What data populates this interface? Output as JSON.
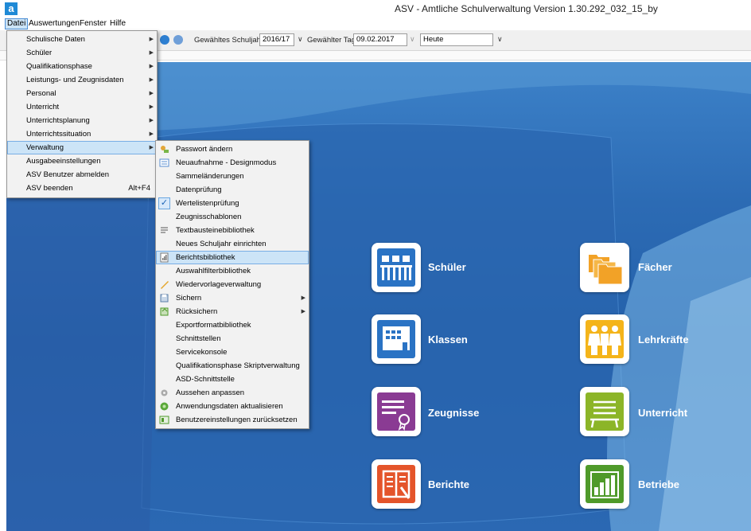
{
  "window": {
    "title": "ASV - Amtliche Schulverwaltung Version 1.30.292_032_15_by",
    "app_icon": "a"
  },
  "menubar": {
    "items": [
      "Datei",
      "Auswertungen",
      "Fenster",
      "Hilfe"
    ]
  },
  "toolbar": {
    "schuljahr_label": "Gewähltes Schuljahr",
    "schuljahr_value": "2016/17",
    "tag_label": "Gewählter Tag",
    "tag_value": "09.02.2017",
    "heute_value": "Heute"
  },
  "datei_menu": {
    "items": [
      "Schulische Daten",
      "Schüler",
      "Qualifikationsphase",
      "Leistungs- und Zeugnisdaten",
      "Personal",
      "Unterricht",
      "Unterrichtsplanung",
      "Unterrichtssituation",
      "Verwaltung",
      "Ausgabeeinstellungen",
      "ASV Benutzer abmelden",
      "ASV beenden"
    ],
    "exit_shortcut": "Alt+F4"
  },
  "verwaltung_menu": {
    "items": [
      "Passwort ändern",
      "Neuaufnahme - Designmodus",
      "Sammeländerungen",
      "Datenprüfung",
      "Wertelistenprüfung",
      "Zeugnisschablonen",
      "Textbausteinebibliothek",
      "Neues Schuljahr einrichten",
      "Berichtsbibliothek",
      "Auswahlfilterbibliothek",
      "Wiedervorlageverwaltung",
      "Sichern",
      "Rücksichern",
      "Exportformatbibliothek",
      "Schnittstellen",
      "Servicekonsole",
      "Qualifikationsphase Skriptverwaltung",
      "ASD-Schnittstelle",
      "Aussehen anpassen",
      "Anwendungsdaten aktualisieren",
      "Benutzereinstellungen zurücksetzen"
    ]
  },
  "tiles": {
    "schueler": "Schüler",
    "klassen": "Klassen",
    "zeugnisse": "Zeugnisse",
    "berichte": "Berichte",
    "faecher": "Fächer",
    "lehrkraefte": "Lehrkräfte",
    "unterricht": "Unterricht",
    "betriebe": "Betriebe"
  },
  "colors": {
    "accent_blue": "#1f8ad6",
    "tile_blue": "#2a73c4",
    "tile_purple": "#8a3b93",
    "tile_red": "#e4542a",
    "tile_orange": "#f2a227",
    "tile_yellow": "#f4b41a",
    "tile_green": "#8cb528",
    "tile_darkgreen": "#4f9a2a",
    "menu_highlight": "#cce4f7"
  }
}
